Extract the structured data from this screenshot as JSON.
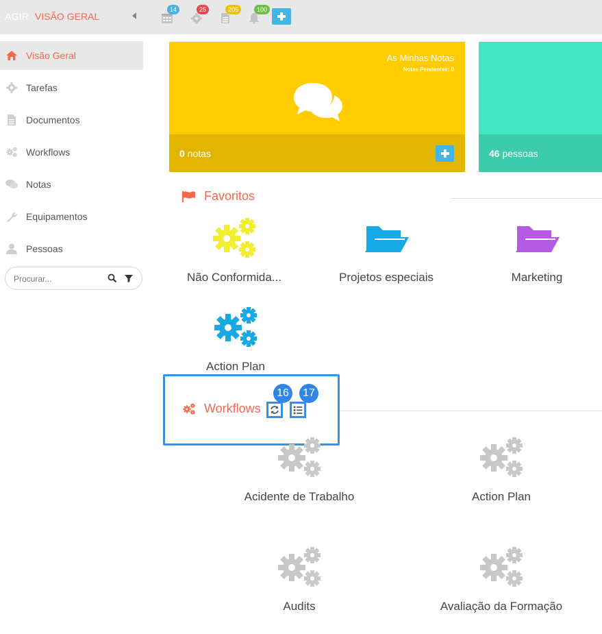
{
  "topbar": {
    "app_name": "AGIR",
    "section_name": "VISÃO GERAL",
    "badges": {
      "calendar": "14",
      "tasks": "25",
      "documents": "205",
      "notifications": "100"
    },
    "colors": {
      "calendar": "#45b5e6",
      "tasks": "#e8484b",
      "documents": "#f2c200",
      "notifications": "#6cbf45"
    }
  },
  "sidebar": {
    "items": [
      {
        "label": "Visão Geral",
        "icon": "home-icon"
      },
      {
        "label": "Tarefas",
        "icon": "gear-icon"
      },
      {
        "label": "Documentos",
        "icon": "document-icon"
      },
      {
        "label": "Workflows",
        "icon": "gears-icon"
      },
      {
        "label": "Notas",
        "icon": "chat-icon"
      },
      {
        "label": "Equipamentos",
        "icon": "wrench-icon"
      },
      {
        "label": "Pessoas",
        "icon": "user-icon"
      }
    ],
    "search_placeholder": "Procurar..."
  },
  "cards": {
    "notes": {
      "title": "As Minhas Notas",
      "subtitle": "Notas Pendentes: 0",
      "count_value": "0",
      "count_unit": "notas"
    },
    "people": {
      "count_value": "46",
      "count_unit": "pessoas"
    }
  },
  "favorites": {
    "title": "Favoritos",
    "items": [
      {
        "label": "Não Conformida...",
        "icon": "gears-icon",
        "color": "#f2ee2e"
      },
      {
        "label": "Projetos especiais",
        "icon": "folder-open-icon",
        "color": "#17a9e3"
      },
      {
        "label": "Marketing",
        "icon": "folder-open-icon",
        "color": "#b25be0"
      },
      {
        "label": "Action Plan",
        "icon": "gears-icon",
        "color": "#17a9e3"
      }
    ]
  },
  "workflows": {
    "title": "Workflows",
    "badge_refresh": "16",
    "badge_list": "17",
    "items": [
      {
        "label": "Acidente de Trabalho",
        "icon": "gears-icon"
      },
      {
        "label": "Action Plan",
        "icon": "gears-icon"
      },
      {
        "label": "Audits",
        "icon": "gears-icon"
      },
      {
        "label": "Avaliação da Formação",
        "icon": "gears-icon"
      }
    ],
    "icon_color": "#c8c8c8"
  }
}
